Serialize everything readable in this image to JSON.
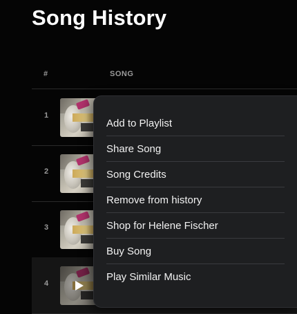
{
  "page": {
    "title": "Song History"
  },
  "table": {
    "headers": {
      "number": "#",
      "song": "SONG"
    },
    "rows": [
      {
        "number": "1"
      },
      {
        "number": "2"
      },
      {
        "number": "3"
      },
      {
        "number": "4"
      }
    ]
  },
  "context_menu": {
    "items": [
      "Add to Playlist",
      "Share Song",
      "Song Credits",
      "Remove from history",
      "Shop for Helene Fischer",
      "Buy Song",
      "Play Similar Music"
    ]
  },
  "icons": {
    "play": "play-icon",
    "album_art": "album-art"
  },
  "colors": {
    "background": "#050505",
    "menu_background": "#1e1f21",
    "divider": "#3a3b3f"
  }
}
